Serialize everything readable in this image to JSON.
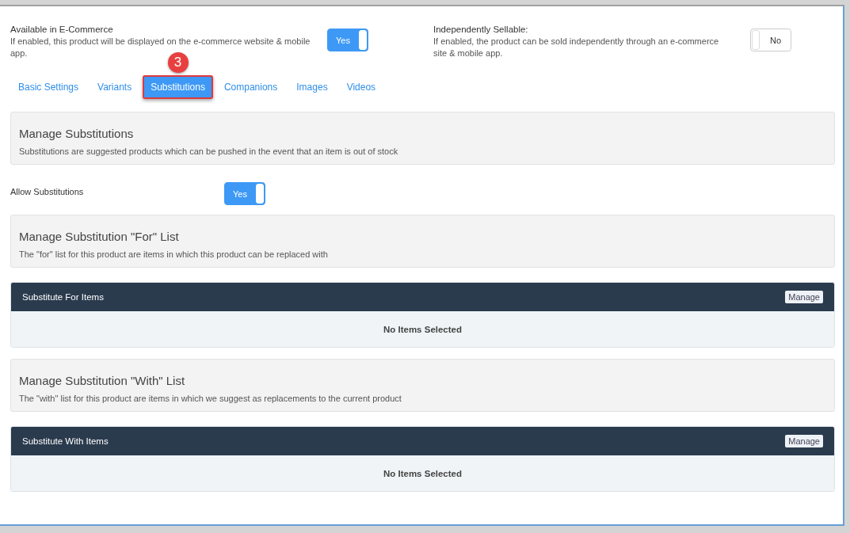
{
  "settings": [
    {
      "title": "Available in E-Commerce",
      "description": "If enabled, this product will be displayed on the e-commerce website & mobile app.",
      "toggle": {
        "label": "Yes",
        "on": true
      }
    },
    {
      "title": "Independently Sellable:",
      "description": "If enabled, the product can be sold independently through an e-commerce site & mobile app.",
      "toggle": {
        "label": "No",
        "on": false
      }
    }
  ],
  "tabs": [
    {
      "label": "Basic Settings",
      "selected": false
    },
    {
      "label": "Variants",
      "selected": false
    },
    {
      "label": "Substitutions",
      "selected": true,
      "marker": "3"
    },
    {
      "label": "Companions",
      "selected": false
    },
    {
      "label": "Images",
      "selected": false
    },
    {
      "label": "Videos",
      "selected": false
    }
  ],
  "sections": [
    {
      "kind": "info",
      "title": "Manage Substitutions",
      "description": "Substitutions are suggested products which can be pushed in the event that an item is out of stock"
    },
    {
      "kind": "toggle",
      "label": "Allow Substitutions",
      "toggle": {
        "label": "Yes",
        "on": true
      }
    },
    {
      "kind": "info",
      "title": "Manage Substitution \"For\" List",
      "description": "The \"for\" list for this product are items in which this product can be replaced with"
    },
    {
      "kind": "panel",
      "title": "Substitute For Items",
      "button": "Manage",
      "empty": "No Items Selected"
    },
    {
      "kind": "info",
      "title": "Manage Substitution \"With\" List",
      "description": "The \"with\" list for this product are items in which we suggest as replacements to the current product"
    },
    {
      "kind": "panel",
      "title": "Substitute With Items",
      "button": "Manage",
      "empty": "No Items Selected"
    }
  ]
}
